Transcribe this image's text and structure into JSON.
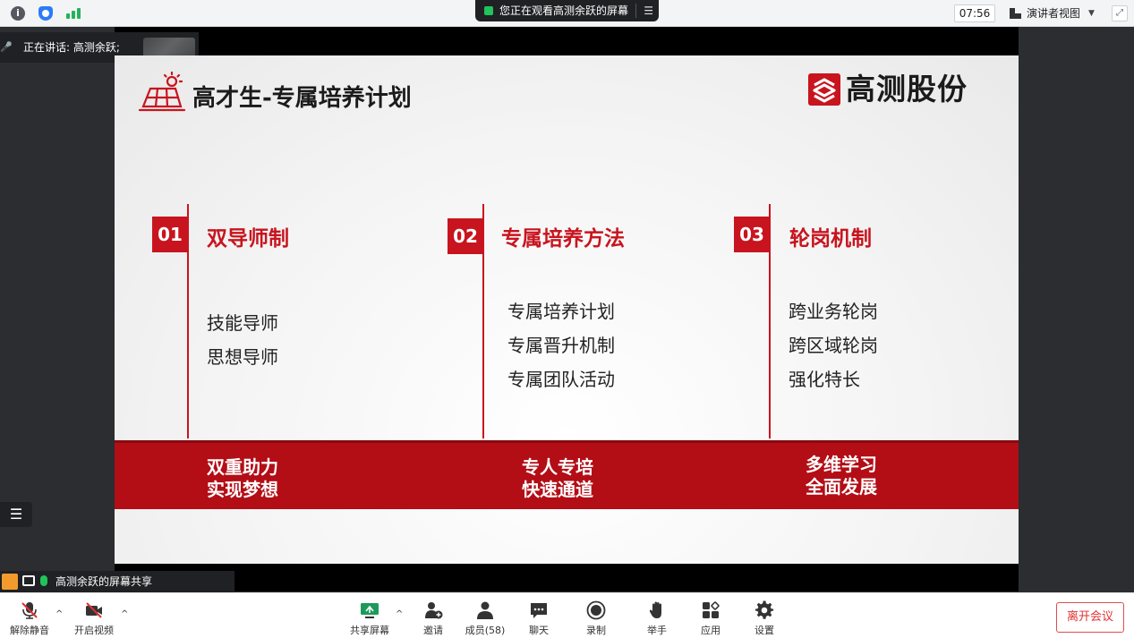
{
  "topbar": {
    "info_glyph": "i",
    "share_banner_text": "您正在观看高测余跃的屏幕",
    "share_menu_glyph": "☰",
    "clock": "07:56",
    "view_label": "演讲者视图",
    "view_caret": "▼",
    "fullscreen_glyph": "⤢"
  },
  "speaking": {
    "label": "正在讲话: 高测余跃;"
  },
  "slide": {
    "title": "高才生-专属培养计划",
    "brand_name": "高测股份",
    "columns": [
      {
        "num": "01",
        "title": "双导师制",
        "items": [
          "技能导师",
          "思想导师"
        ]
      },
      {
        "num": "02",
        "title": "专属培养方法",
        "items": [
          "专属培养计划",
          "专属晋升机制",
          "专属团队活动"
        ]
      },
      {
        "num": "03",
        "title": "轮岗机制",
        "items": [
          "跨业务轮岗",
          "跨区域轮岗",
          "强化特长"
        ]
      }
    ],
    "banner": [
      {
        "line1": "双重助力",
        "line2": "实现梦想"
      },
      {
        "line1": "专人专培",
        "line2": "快速通道"
      },
      {
        "line1": "多维学习",
        "line2": "全面发展"
      }
    ],
    "accent_color": "#c8141e"
  },
  "sidebar": {
    "list_glyph": "☰"
  },
  "sharer": {
    "label": "高测余跃的屏幕共享"
  },
  "toolbar": {
    "unmute": "解除静音",
    "start_video": "开启视频",
    "share_screen": "共享屏幕",
    "invite": "邀请",
    "members": "成员(58)",
    "chat": "聊天",
    "record": "录制",
    "raise_hand": "举手",
    "apps": "应用",
    "settings": "设置",
    "leave": "离开会议",
    "caret": "^"
  }
}
